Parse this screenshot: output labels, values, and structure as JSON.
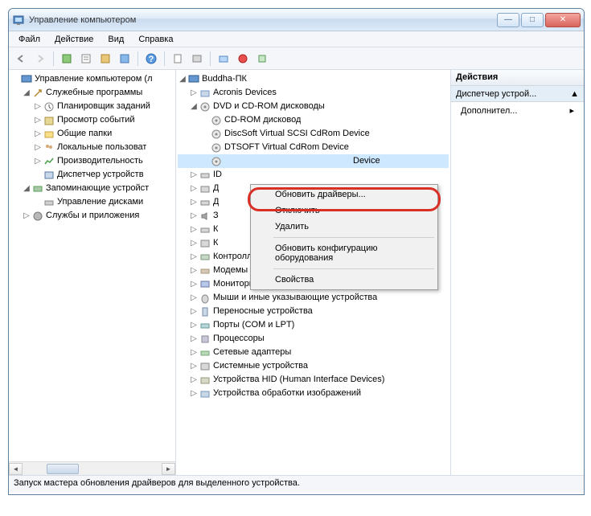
{
  "window": {
    "title": "Управление компьютером"
  },
  "menu": {
    "file": "Файл",
    "action": "Действие",
    "view": "Вид",
    "help": "Справка"
  },
  "left_tree": {
    "root": "Управление компьютером (л",
    "sys_tools": "Служебные программы",
    "scheduler": "Планировщик заданий",
    "eventvwr": "Просмотр событий",
    "shared": "Общие папки",
    "users": "Локальные пользоват",
    "perf": "Производительность",
    "devmgr": "Диспетчер устройств",
    "storage": "Запоминающие устройст",
    "diskmgmt": "Управление дисками",
    "services": "Службы и приложения"
  },
  "center_tree": {
    "root": "Buddha-ПК",
    "acronis": "Acronis Devices",
    "dvd": "DVD и CD-ROM дисководы",
    "cdrom": "CD-ROM дисковод",
    "discsoft": "DiscSoft Virtual SCSI CdRom Device",
    "dtsoft": "DTSOFT Virtual CdRom Device",
    "selected": "Device",
    "ide": "ID",
    "d1": "Д",
    "d2": "Д",
    "d3": "З",
    "d4": "К",
    "d5": "К",
    "controllers": "Контроллеры запоминающих устройств",
    "modems": "Модемы",
    "monitors": "Мониторы",
    "mice": "Мыши и иные указывающие устройства",
    "portable": "Переносные устройства",
    "ports": "Порты (COM и LPT)",
    "cpu": "Процессоры",
    "netadapters": "Сетевые адаптеры",
    "sysdev": "Системные устройства",
    "hid": "Устройства HID (Human Interface Devices)",
    "imaging": "Устройства обработки изображений"
  },
  "context_menu": {
    "update": "Обновить драйверы...",
    "disable": "Отключить",
    "delete": "Удалить",
    "scan": "Обновить конфигурацию оборудования",
    "props": "Свойства"
  },
  "actions": {
    "header": "Действия",
    "sub": "Диспетчер устрой...",
    "more": "Дополнител..."
  },
  "status": "Запуск мастера обновления драйверов для выделенного устройства."
}
